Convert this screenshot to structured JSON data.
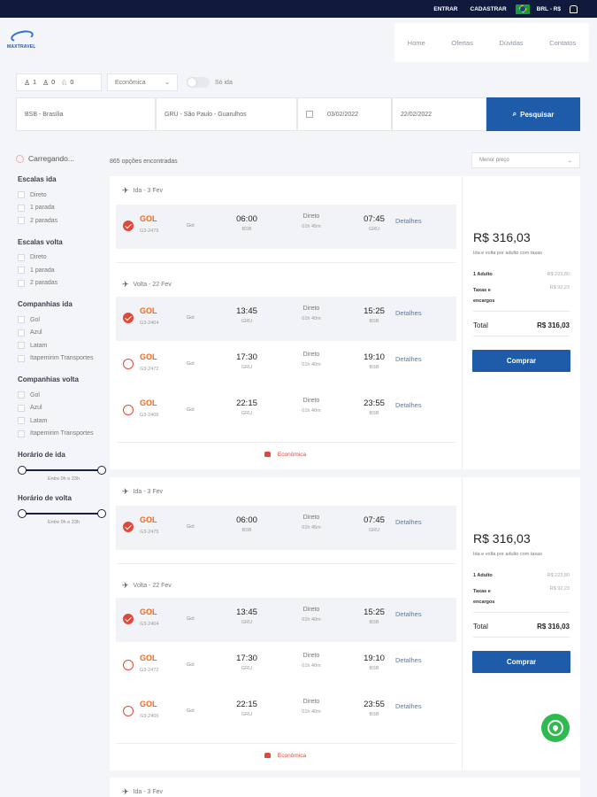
{
  "topbar": {
    "login": "ENTRAR",
    "register": "CADASTRAR",
    "currency": "BRL - R$"
  },
  "logo": {
    "text": "MAXTRAVEL"
  },
  "nav": [
    "Home",
    "Ofertas",
    "Dúvidas",
    "Contatos"
  ],
  "search": {
    "adults": "1",
    "children": "0",
    "infants": "0",
    "cabin": "Econômica",
    "one_way_label": "Só ida",
    "origin": "BSB - Brasília",
    "destination": "GRU - São Paulo - Guarulhos",
    "depart_date": "03/02/2022",
    "return_date": "22/02/2022",
    "button": "Pesquisar"
  },
  "results": {
    "loading": "Carregando...",
    "count": "865 opções encontradas",
    "sort": "Menor preço"
  },
  "filters": {
    "stops_out": {
      "title": "Escalas ida",
      "items": [
        "Direto",
        "1 parada",
        "2 paradas"
      ]
    },
    "stops_back": {
      "title": "Escalas volta",
      "items": [
        "Direto",
        "1 parada",
        "2 paradas"
      ]
    },
    "airlines_out": {
      "title": "Companhias ida",
      "items": [
        "Gol",
        "Azul",
        "Latam",
        "Itapemirim Transportes"
      ]
    },
    "airlines_back": {
      "title": "Companhias volta",
      "items": [
        "Gol",
        "Azul",
        "Latam",
        "Itapemirim Transportes"
      ]
    },
    "time_out": {
      "title": "Horário de ida",
      "range": "Entre 0h e 23h"
    },
    "time_back": {
      "title": "Horário de volta",
      "range": "Entre 0h e 23h"
    }
  },
  "cards": [
    {
      "out_title": "Ida - 3 Fev",
      "back_title": "Volta - 22 Fev",
      "out": [
        {
          "airline": "GOL",
          "code": "G3-2475",
          "name": "Gol",
          "dep": "06:00",
          "dep_ap": "BSB",
          "type": "Direto",
          "dur": "01h 45m",
          "arr": "07:45",
          "arr_ap": "GRU",
          "details": "Detalhes",
          "selected": true
        }
      ],
      "back": [
        {
          "airline": "GOL",
          "code": "G3-2404",
          "name": "Gol",
          "dep": "13:45",
          "dep_ap": "GRU",
          "type": "Direto",
          "dur": "01h 40m",
          "arr": "15:25",
          "arr_ap": "BSB",
          "details": "Detalhes",
          "selected": true
        },
        {
          "airline": "GOL",
          "code": "G3-2472",
          "name": "Gol",
          "dep": "17:30",
          "dep_ap": "GRU",
          "type": "Direto",
          "dur": "01h 40m",
          "arr": "19:10",
          "arr_ap": "BSB",
          "details": "Detalhes",
          "selected": false
        },
        {
          "airline": "GOL",
          "code": "G3-2406",
          "name": "Gol",
          "dep": "22:15",
          "dep_ap": "GRU",
          "type": "Direto",
          "dur": "01h 40m",
          "arr": "23:55",
          "arr_ap": "BSB",
          "details": "Detalhes",
          "selected": false
        }
      ],
      "cabin": "Econômica",
      "price": "R$ 316,03",
      "price_sub": "Ida e volta por adulto com taxas",
      "adult_label": "1 Adulto",
      "adult_value": "R$ 223,80",
      "tax_label": "Taxas e encargos",
      "tax_value": "R$ 92,23",
      "total_label": "Total",
      "total_value": "R$ 316,03",
      "buy": "Comprar"
    },
    {
      "out_title": "Ida - 3 Fev",
      "back_title": "Volta - 22 Fev",
      "out": [
        {
          "airline": "GOL",
          "code": "G3-2475",
          "name": "Gol",
          "dep": "06:00",
          "dep_ap": "BSB",
          "type": "Direto",
          "dur": "01h 45m",
          "arr": "07:45",
          "arr_ap": "GRU",
          "details": "Detalhes",
          "selected": true
        }
      ],
      "back": [
        {
          "airline": "GOL",
          "code": "G3-2404",
          "name": "Gol",
          "dep": "13:45",
          "dep_ap": "GRU",
          "type": "Direto",
          "dur": "01h 40m",
          "arr": "15:25",
          "arr_ap": "BSB",
          "details": "Detalhes",
          "selected": true
        },
        {
          "airline": "GOL",
          "code": "G3-2472",
          "name": "Gol",
          "dep": "17:30",
          "dep_ap": "GRU",
          "type": "Direto",
          "dur": "01h 40m",
          "arr": "19:10",
          "arr_ap": "BSB",
          "details": "Detalhes",
          "selected": false
        },
        {
          "airline": "GOL",
          "code": "G3-2406",
          "name": "Gol",
          "dep": "22:15",
          "dep_ap": "GRU",
          "type": "Direto",
          "dur": "01h 40m",
          "arr": "23:55",
          "arr_ap": "BSB",
          "details": "Detalhes",
          "selected": false
        }
      ],
      "cabin": "Econômica",
      "price": "R$ 316,03",
      "price_sub": "Ida e volta por adulto com taxas",
      "adult_label": "1 Adulto",
      "adult_value": "R$ 223,80",
      "tax_label": "Taxas e encargos",
      "tax_value": "R$ 92,23",
      "total_label": "Total",
      "total_value": "R$ 316,03",
      "buy": "Comprar"
    }
  ],
  "partial_card": {
    "out_title": "Ida - 3 Fev"
  },
  "colors": {
    "navy": "#0f1a3c",
    "primary": "#1e5ba8",
    "gol_orange": "#f06a1b",
    "accent_red": "#e0483a",
    "whatsapp": "#2dbb4f"
  }
}
